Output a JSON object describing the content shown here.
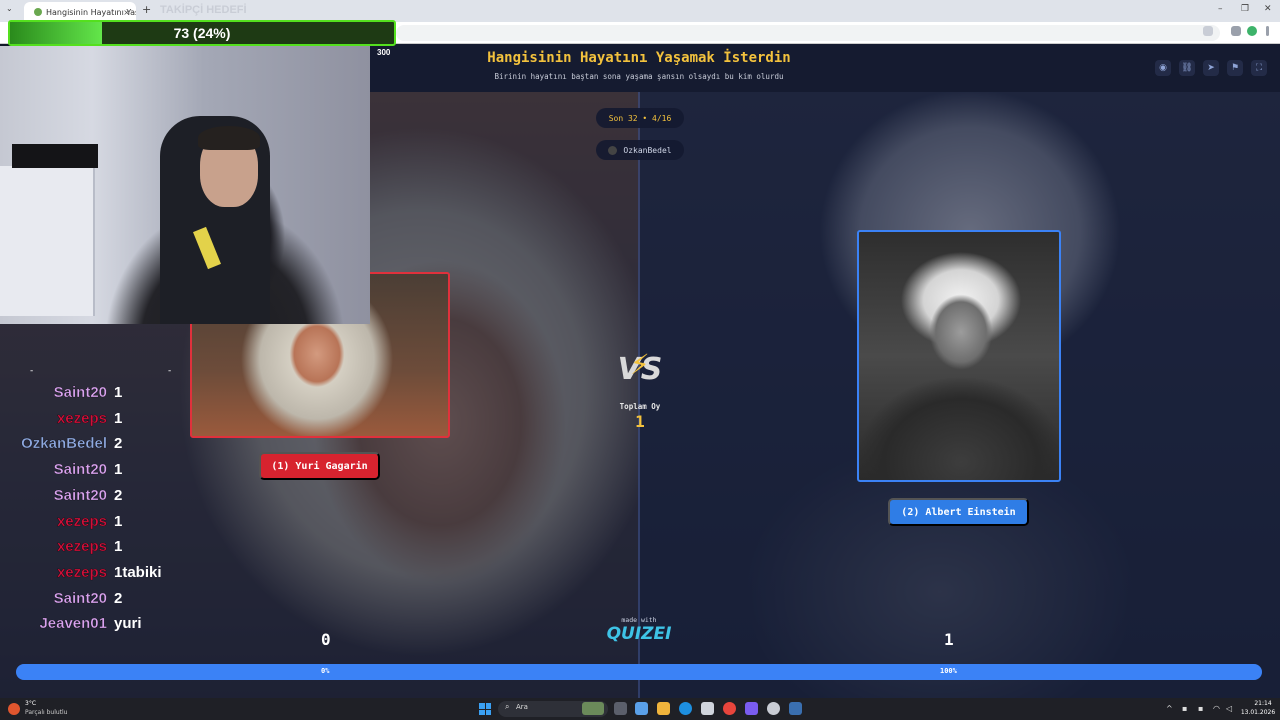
{
  "browser": {
    "tab_title": "Hangisinin Hayatını Yaşamak İs",
    "tab_close": "×",
    "new_tab": "+",
    "menu": "⌄",
    "minimize": "–",
    "restore": "❐",
    "close": "✕"
  },
  "overlay": {
    "follower_title": "TAKİPÇİ HEDEFİ",
    "follower_progress_text": "73 (24%)",
    "follower_progress_fraction": 0.24,
    "follower_goal_marker": "300"
  },
  "quiz": {
    "title": "Hangisinin Hayatını Yaşamak İsterdin",
    "subtitle": "Birinin hayatını baştan sona yaşama şansın olsaydı bu kim olurdu",
    "round": "Son 32 • 4/16",
    "player": "OzkanBedel",
    "vs_label": "VS",
    "total_votes_label": "Toplam Oy",
    "total_votes_value": "1",
    "made_with": "made with",
    "brand": "QUIZEI",
    "left": {
      "button_label": "(1) Yuri Gagarin",
      "score": "0",
      "percent_label": "0%",
      "percent_value": 0
    },
    "right": {
      "button_label": "(2) Albert Einstein",
      "score": "1",
      "percent_label": "100%",
      "percent_value": 100
    },
    "accent_color": "#f3c23d",
    "left_color": "#d7232f",
    "right_color": "#2f7de6"
  },
  "chat": [
    {
      "user": "Saint20",
      "msg": "1",
      "color": "#d9a3f0"
    },
    {
      "user": "xezeps",
      "msg": "1",
      "color": "#d0103a"
    },
    {
      "user": "OzkanBedel",
      "msg": "2",
      "color": "#8ea8e0"
    },
    {
      "user": "Saint20",
      "msg": "1",
      "color": "#d9a3f0"
    },
    {
      "user": "Saint20",
      "msg": "2",
      "color": "#d9a3f0"
    },
    {
      "user": "xezeps",
      "msg": "1",
      "color": "#d0103a"
    },
    {
      "user": "xezeps",
      "msg": "1",
      "color": "#d0103a"
    },
    {
      "user": "xezeps",
      "msg": "1tabiki",
      "color": "#d0103a"
    },
    {
      "user": "Saint20",
      "msg": "2",
      "color": "#d9a3f0"
    },
    {
      "user": "Jeaven01",
      "msg": "yuri",
      "color": "#d9a3f0"
    }
  ],
  "taskbar": {
    "weather_temp": "3°C",
    "weather_desc": "Parçalı bulutlu",
    "search_placeholder": "Ara",
    "time": "21:14",
    "date": "13.01.2026"
  }
}
